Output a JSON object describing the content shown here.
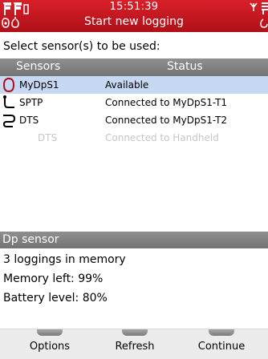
{
  "status_bar": {
    "time": "15:51:39",
    "title": "Start new logging"
  },
  "prompt": "Select sensor(s) to be used:",
  "table": {
    "headers": {
      "sensors": "Sensors",
      "status": "Status"
    },
    "rows": [
      {
        "icon": "dp-sensor-icon",
        "name": "MyDpS1",
        "status": "Available",
        "selected": true,
        "available": true
      },
      {
        "icon": "probe-icon",
        "name": "SPTP",
        "status": "Connected to MyDpS1-T1",
        "selected": false,
        "available": true
      },
      {
        "icon": "probe-icon",
        "name": "DTS",
        "status": "Connected to MyDpS1-T2",
        "selected": false,
        "available": true
      },
      {
        "icon": "",
        "name": "DTS",
        "status": "Connected to Handheld",
        "selected": false,
        "available": false
      }
    ]
  },
  "details": {
    "title": "Dp sensor",
    "lines": [
      "3 loggings in memory",
      "Memory left: 99%",
      "Battery level: 80%"
    ]
  },
  "softkeys": [
    "Options",
    "Refresh",
    "Continue"
  ],
  "colors": {
    "header_red": "#c0161f",
    "table_header_gray": "#808080",
    "selection_blue": "#c6d8f2"
  }
}
